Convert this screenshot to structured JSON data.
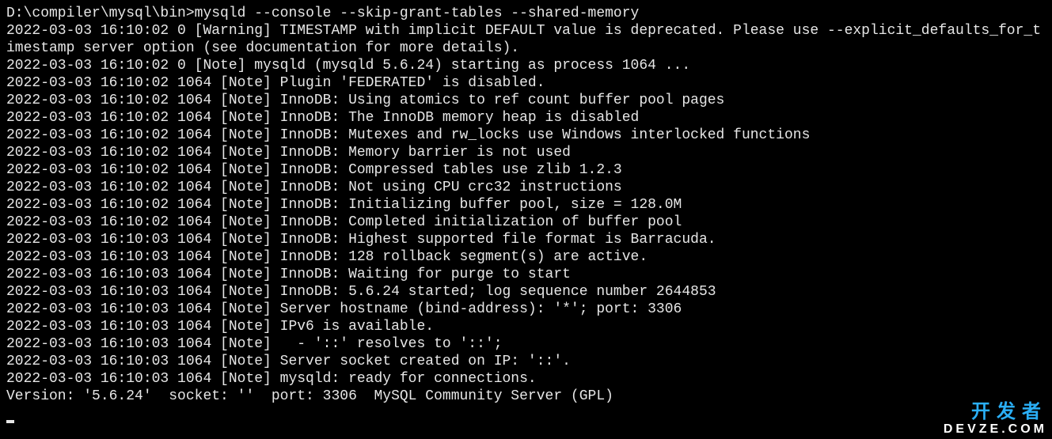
{
  "prompt": "D:\\compiler\\mysql\\bin>",
  "command": "mysqld --console --skip-grant-tables --shared-memory",
  "lines": [
    "2022-03-03 16:10:02 0 [Warning] TIMESTAMP with implicit DEFAULT value is deprecated. Please use --explicit_defaults_for_timestamp server option (see documentation for more details).",
    "2022-03-03 16:10:02 0 [Note] mysqld (mysqld 5.6.24) starting as process 1064 ...",
    "2022-03-03 16:10:02 1064 [Note] Plugin 'FEDERATED' is disabled.",
    "2022-03-03 16:10:02 1064 [Note] InnoDB: Using atomics to ref count buffer pool pages",
    "2022-03-03 16:10:02 1064 [Note] InnoDB: The InnoDB memory heap is disabled",
    "2022-03-03 16:10:02 1064 [Note] InnoDB: Mutexes and rw_locks use Windows interlocked functions",
    "2022-03-03 16:10:02 1064 [Note] InnoDB: Memory barrier is not used",
    "2022-03-03 16:10:02 1064 [Note] InnoDB: Compressed tables use zlib 1.2.3",
    "2022-03-03 16:10:02 1064 [Note] InnoDB: Not using CPU crc32 instructions",
    "2022-03-03 16:10:02 1064 [Note] InnoDB: Initializing buffer pool, size = 128.0M",
    "2022-03-03 16:10:02 1064 [Note] InnoDB: Completed initialization of buffer pool",
    "2022-03-03 16:10:03 1064 [Note] InnoDB: Highest supported file format is Barracuda.",
    "2022-03-03 16:10:03 1064 [Note] InnoDB: 128 rollback segment(s) are active.",
    "2022-03-03 16:10:03 1064 [Note] InnoDB: Waiting for purge to start",
    "2022-03-03 16:10:03 1064 [Note] InnoDB: 5.6.24 started; log sequence number 2644853",
    "2022-03-03 16:10:03 1064 [Note] Server hostname (bind-address): '*'; port: 3306",
    "2022-03-03 16:10:03 1064 [Note] IPv6 is available.",
    "2022-03-03 16:10:03 1064 [Note]   - '::' resolves to '::';",
    "2022-03-03 16:10:03 1064 [Note] Server socket created on IP: '::'.",
    "2022-03-03 16:10:03 1064 [Note] mysqld: ready for connections.",
    "Version: '5.6.24'  socket: ''  port: 3306  MySQL Community Server (GPL)"
  ],
  "watermark": {
    "top": "开发者",
    "bottom": "DEVZE.COM"
  }
}
